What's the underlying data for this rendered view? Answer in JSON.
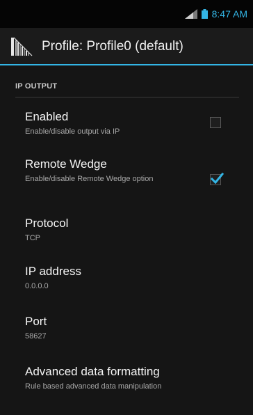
{
  "status_bar": {
    "time": "8:47 AM",
    "icons": [
      "signal-icon",
      "battery-icon"
    ],
    "accent_color": "#33b5e5"
  },
  "action_bar": {
    "title": "Profile: Profile0 (default)",
    "icon": "datawedge-app-icon"
  },
  "category": {
    "title": "IP OUTPUT"
  },
  "preferences": [
    {
      "title": "Enabled",
      "summary": "Enable/disable output via IP",
      "checked": false
    },
    {
      "title": "Remote Wedge",
      "summary": "Enable/disable Remote Wedge option",
      "checked": true
    },
    {
      "title": "Protocol",
      "summary": "TCP"
    },
    {
      "title": "IP address",
      "summary": "0.0.0.0"
    },
    {
      "title": "Port",
      "summary": "58627"
    },
    {
      "title": "Advanced data formatting",
      "summary": "Rule based advanced data manipulation"
    }
  ]
}
